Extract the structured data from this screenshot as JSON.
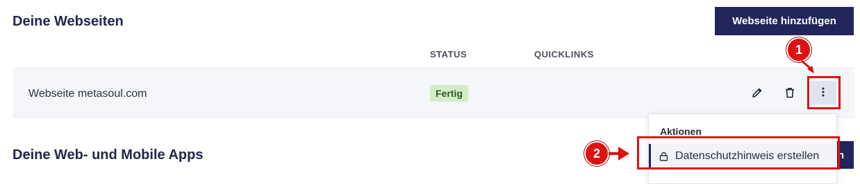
{
  "websites": {
    "title": "Deine Webseiten",
    "add_button": "Webseite hinzufügen",
    "columns": {
      "status": "STATUS",
      "quicklinks": "QUICKLINKS"
    },
    "rows": [
      {
        "name": "Webseite metasoul.com",
        "status": "Fertig"
      }
    ]
  },
  "apps": {
    "title": "Deine Web- und Mobile Apps",
    "add_button_visible_fragment": "n"
  },
  "dropdown": {
    "header": "Aktionen",
    "items": [
      {
        "label": "Datenschutzhinweis erstellen",
        "icon": "lock-icon"
      }
    ]
  },
  "annotations": {
    "marker_1": "1",
    "marker_2": "2",
    "color": "#dd1111"
  },
  "colors": {
    "primary": "#23265a",
    "badge_bg": "#d4edc9",
    "row_bg": "#f4f6fa"
  }
}
